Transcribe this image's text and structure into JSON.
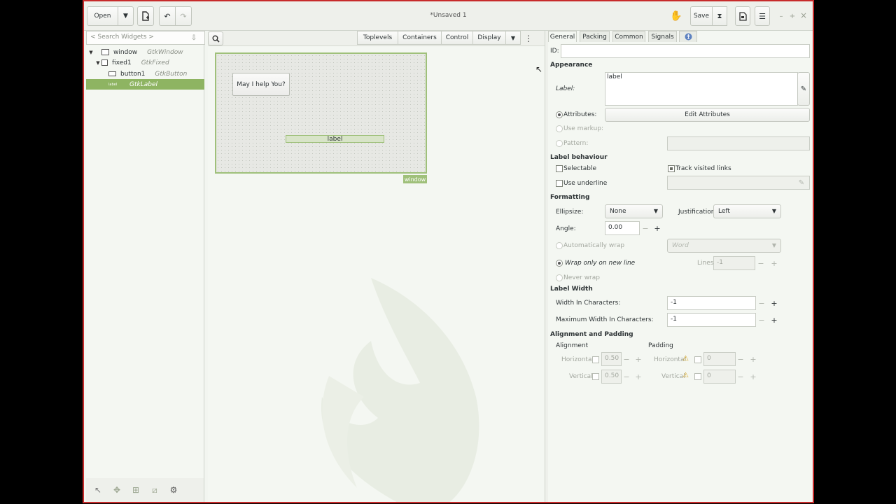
{
  "header": {
    "open_label": "Open",
    "title": "*Unsaved 1",
    "save_label": "Save",
    "win_min": "–",
    "win_max": "+",
    "win_close": "×"
  },
  "tree": {
    "search_placeholder": "< Search Widgets >",
    "rows": [
      {
        "name": "window",
        "type": "GtkWindow"
      },
      {
        "name": "fixed1",
        "type": "GtkFixed"
      },
      {
        "name": "button1",
        "type": "GtkButton"
      },
      {
        "name": "",
        "type": "GtkLabel"
      }
    ],
    "label_icon_text": "label"
  },
  "palette": {
    "toplevels": "Toplevels",
    "containers": "Containers",
    "control": "Control",
    "display": "Display"
  },
  "canvas": {
    "button_text": "May I help You?",
    "label_text": "label",
    "window_tag": "window"
  },
  "tabs": {
    "general": "General",
    "packing": "Packing",
    "common": "Common",
    "signals": "Signals"
  },
  "props": {
    "id_label": "ID:",
    "id_value": "",
    "appearance": "Appearance",
    "label_label": "Label:",
    "label_value": "label",
    "attributes": "Attributes:",
    "edit_attributes": "Edit Attributes",
    "use_markup": "Use markup:",
    "pattern": "Pattern:",
    "label_behaviour": "Label behaviour",
    "selectable": "Selectable",
    "track_visited": "Track visited links",
    "use_underline": "Use underline",
    "formatting": "Formatting",
    "ellipsize": "Ellipsize:",
    "ellipsize_value": "None",
    "justification": "Justification:",
    "justification_value": "Left",
    "angle": "Angle:",
    "angle_value": "0.00",
    "auto_wrap": "Automatically wrap",
    "wrap_mode_value": "Word",
    "wrap_newline": "Wrap only on new line",
    "lines": "Lines",
    "lines_value": "-1",
    "never_wrap": "Never wrap",
    "label_width": "Label Width",
    "width_chars": "Width In Characters:",
    "width_chars_value": "-1",
    "max_width_chars": "Maximum Width In Characters:",
    "max_width_chars_value": "-1",
    "align_padding": "Alignment and Padding",
    "alignment": "Alignment",
    "padding": "Padding",
    "horizontal": "Horizontal",
    "vertical": "Vertical",
    "halign_value": "0.50",
    "valign_value": "0.50",
    "hpad_value": "0",
    "vpad_value": "0"
  }
}
